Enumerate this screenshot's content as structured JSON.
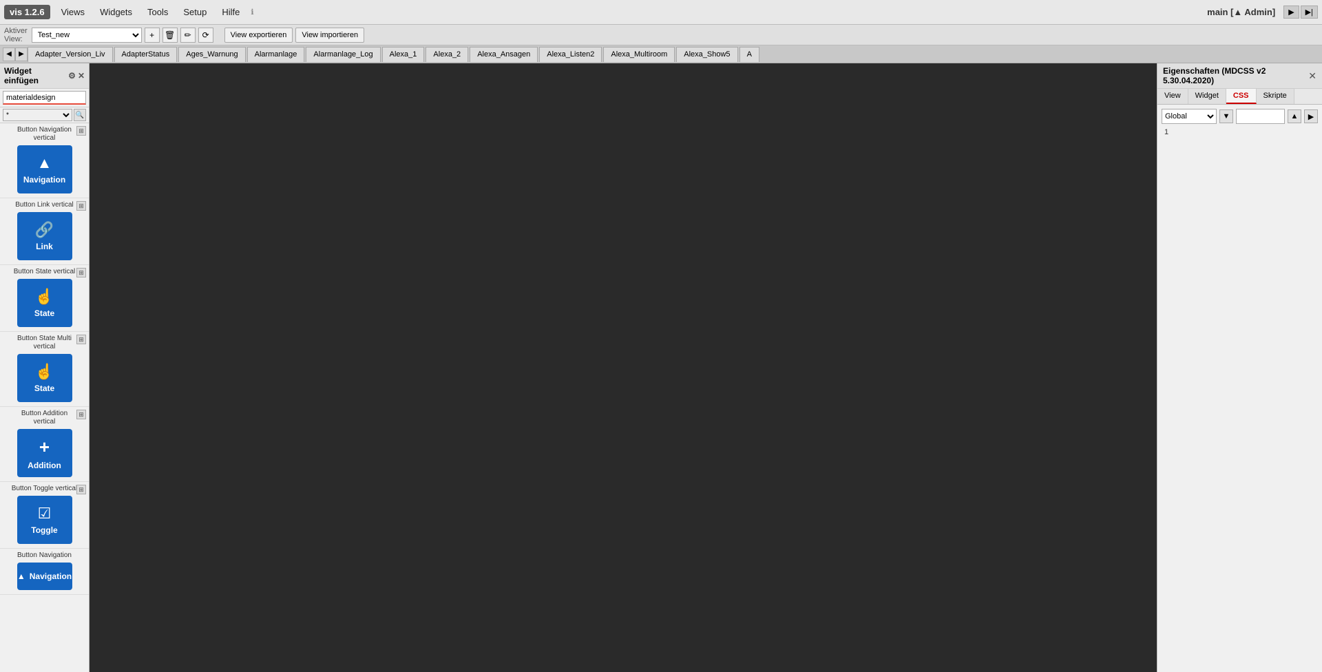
{
  "app": {
    "title": "vis 1.2.6",
    "menu_items": [
      "Views",
      "Widgets",
      "Tools",
      "Setup",
      "Hilfe"
    ],
    "top_right": "main [▲ Admin]",
    "arrow_btns": [
      "▶",
      "▶|"
    ]
  },
  "toolbar": {
    "active_label": "Aktiver\nView:",
    "view_name": "Test_new",
    "icon_btns": [
      "+",
      "🗑",
      "✏",
      "⟳"
    ],
    "export_btn": "View exportieren",
    "import_btn": "View importieren"
  },
  "tabs": [
    "Adapter_Version_Liv",
    "AdapterStatus",
    "Ages_Warnung",
    "Alarmanlage",
    "Alarmanlage_Log",
    "Alexa_1",
    "Alexa_2",
    "Alexa_Ansagen",
    "Alexa_Listen2",
    "Alexa_Multiroom",
    "Alexa_Show5",
    "A"
  ],
  "sidebar": {
    "title": "Widget einfügen",
    "search_placeholder": "materialdesign",
    "filter_value": "*",
    "widgets": [
      {
        "title": "Button Navigation\nvertical",
        "icon": "▲",
        "label": "Navigation"
      },
      {
        "title": "Button Link vertical",
        "icon": "🔗",
        "label": "Link"
      },
      {
        "title": "Button State vertical",
        "icon": "☝",
        "label": "State"
      },
      {
        "title": "Button State Multi\nvertical",
        "icon": "☝",
        "label": "State"
      },
      {
        "title": "Button Addition\nvertical",
        "icon": "+",
        "label": "Addition"
      },
      {
        "title": "Button Toggle vertical",
        "icon": "✓",
        "label": "Toggle"
      },
      {
        "title": "Button Navigation",
        "icon": "▲",
        "label": "Navigation"
      }
    ]
  },
  "right_panel": {
    "title": "Eigenschaften (MDCSS v2 5.30.04.2020)",
    "close_btn": "✕",
    "tabs": [
      "View",
      "Widget",
      "CSS",
      "Skripte"
    ],
    "active_tab": "CSS",
    "global_label": "Global",
    "line_number": "1"
  }
}
